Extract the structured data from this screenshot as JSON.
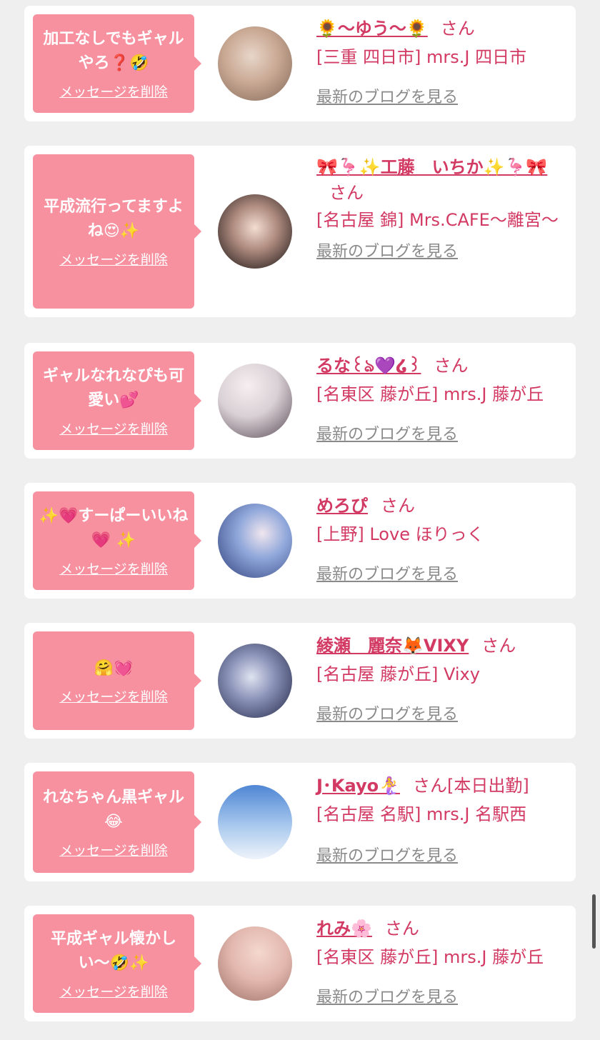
{
  "delete_label": "メッセージを削除",
  "blog_label": "最新のブログを見る",
  "san_label": "さん",
  "entries": [
    {
      "message": "加工なしでもギャルやろ❓🤣",
      "name": "🌻〜ゆう〜🌻",
      "suffix": "",
      "shop": "[三重 四日市] mrs.J 四日市"
    },
    {
      "message": "平成流行ってますよね😍✨",
      "name": "🎀🦩✨工藤　いちか✨🦩🎀",
      "suffix": "",
      "shop": "[名古屋 錦] Mrs.CAFE〜離宮〜"
    },
    {
      "message": "ギャルなれなぴも可愛い💕",
      "name": "るな꒰ঌ💜໒꒱",
      "suffix": "",
      "shop": "[名東区 藤が丘] mrs.J 藤が丘"
    },
    {
      "message": "✨💗すーぱーいいね💗 ✨",
      "name": "めろぴ",
      "suffix": "",
      "shop": "[上野] Love ほりっく"
    },
    {
      "message": "🤗💓",
      "name": "綾瀬　麗奈🦊VIXY",
      "suffix": "",
      "shop": "[名古屋 藤が丘] Vixy"
    },
    {
      "message": "れなちゃん黒ギャル😂",
      "name": "J･Kayo🧜‍♀️",
      "suffix": "[本日出勤]",
      "shop": "[名古屋 名駅] mrs.J 名駅西"
    },
    {
      "message": "平成ギャル懐かしい〜🤣✨",
      "name": "れみ🌸",
      "suffix": "",
      "shop": "[名東区 藤が丘] mrs.J 藤が丘"
    }
  ],
  "avatars": [
    {
      "icon": "avatar-photo-1",
      "color": "#c9a893"
    },
    {
      "icon": "avatar-photo-2",
      "color": "#3a2e2b"
    },
    {
      "icon": "avatar-photo-3",
      "color": "#d8d0d4"
    },
    {
      "icon": "avatar-photo-4",
      "color": "#6a88c4"
    },
    {
      "icon": "avatar-photo-5",
      "color": "#3d4566"
    },
    {
      "icon": "avatar-photo-6",
      "color": "#6f9fd8"
    },
    {
      "icon": "avatar-photo-7",
      "color": "#e2b7ae"
    }
  ],
  "colors": {
    "bubble": "#f7909f",
    "accent": "#d23a63",
    "link_gray": "#8a8a8a",
    "background": "#efefef"
  }
}
